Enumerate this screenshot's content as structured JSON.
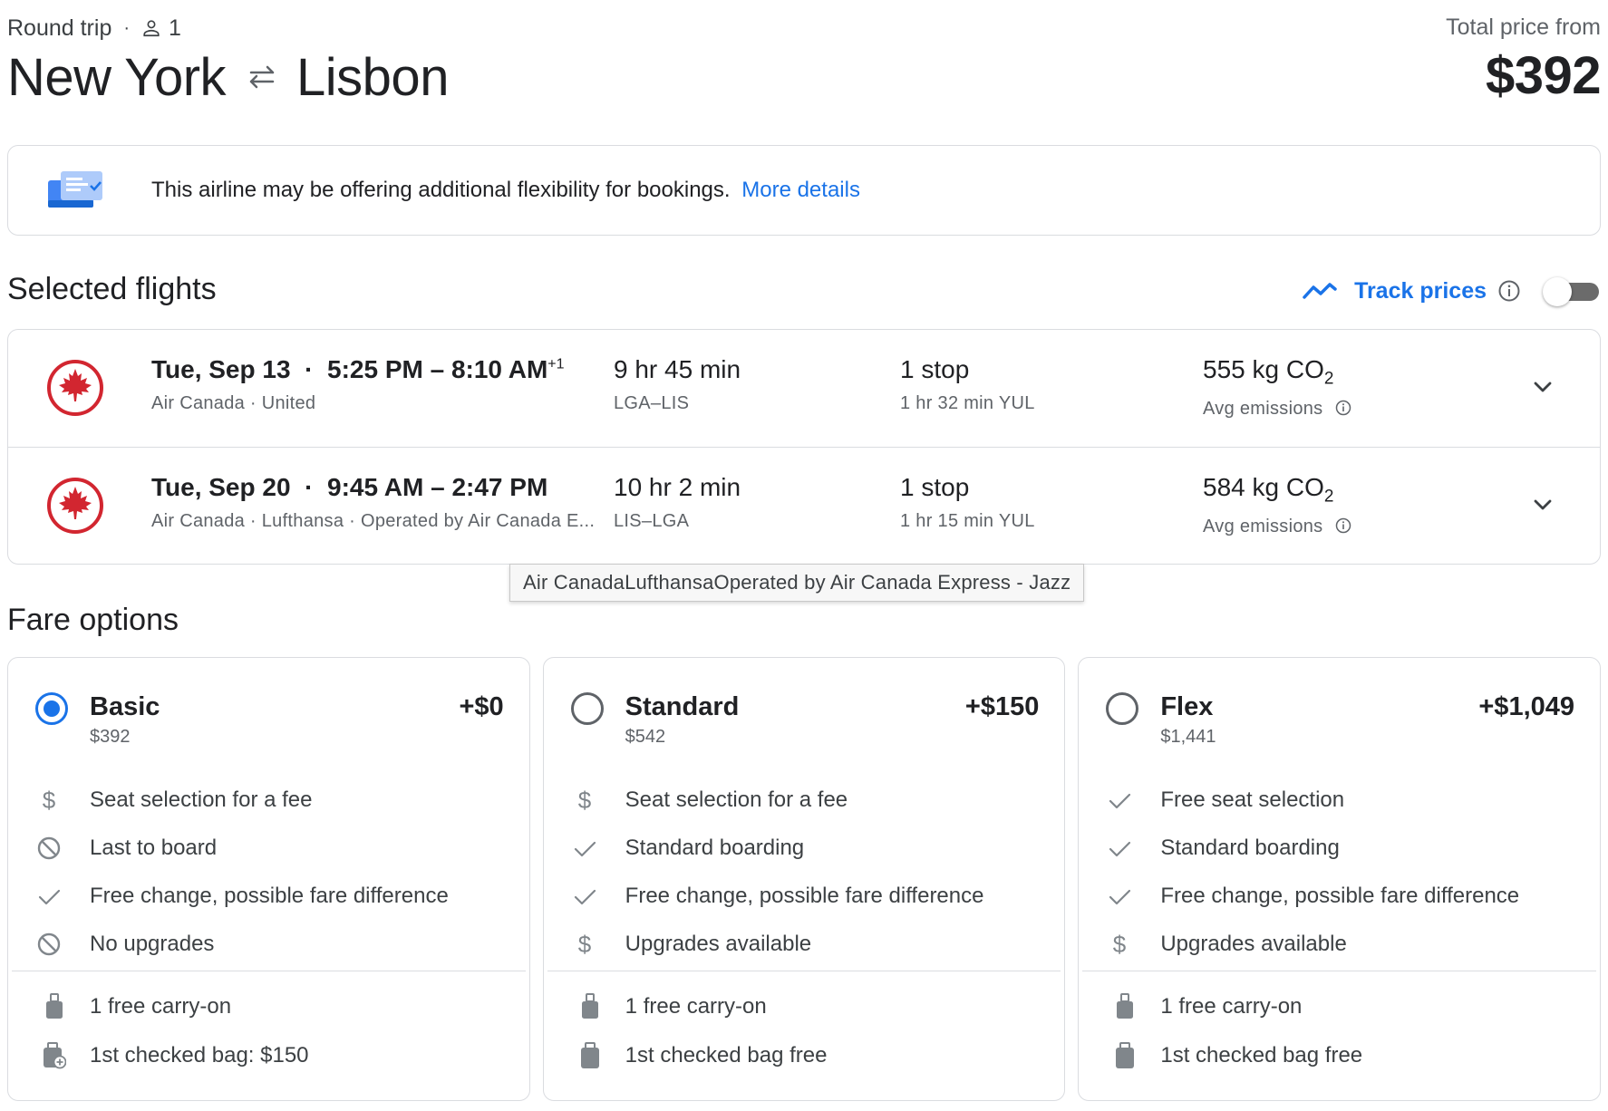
{
  "header": {
    "trip_type": "Round trip",
    "passengers": "1",
    "origin": "New York",
    "destination": "Lisbon",
    "total_label": "Total price from",
    "total_price": "$392"
  },
  "banner": {
    "text": "This airline may be offering additional flexibility for bookings.",
    "link": "More details"
  },
  "selected_flights": {
    "title": "Selected flights",
    "track_prices_label": "Track prices",
    "track_prices_on": false,
    "flights": [
      {
        "date": "Tue, Sep 13",
        "times": "5:25 PM – 8:10 AM",
        "day_offset": "+1",
        "airlines": "Air Canada · United",
        "duration": "9 hr 45 min",
        "airports": "LGA–LIS",
        "stops": "1 stop",
        "layover": "1 hr 32 min YUL",
        "emissions_value": "555 kg CO",
        "emissions_sub": "2",
        "emissions_label": "Avg emissions"
      },
      {
        "date": "Tue, Sep 20",
        "times": "9:45 AM – 2:47 PM",
        "day_offset": "",
        "airlines": "Air Canada · Lufthansa · Operated by Air Canada E...",
        "duration": "10 hr 2 min",
        "airports": "LIS–LGA",
        "stops": "1 stop",
        "layover": "1 hr 15 min YUL",
        "emissions_value": "584 kg CO",
        "emissions_sub": "2",
        "emissions_label": "Avg emissions"
      }
    ],
    "tooltip": "Air CanadaLufthansaOperated by Air Canada Express - Jazz"
  },
  "fare_options": {
    "title": "Fare options",
    "fares": [
      {
        "name": "Basic",
        "price": "$392",
        "delta": "+$0",
        "selected": true,
        "features": [
          {
            "icon": "dollar-icon",
            "text": "Seat selection for a fee"
          },
          {
            "icon": "prohibited-icon",
            "text": "Last to board"
          },
          {
            "icon": "check-icon",
            "text": "Free change, possible fare difference"
          },
          {
            "icon": "prohibited-icon",
            "text": "No upgrades"
          }
        ],
        "bags": [
          {
            "icon": "carry-on-icon",
            "text": "1 free carry-on"
          },
          {
            "icon": "checked-bag-add-icon",
            "text": "1st checked bag: $150"
          }
        ]
      },
      {
        "name": "Standard",
        "price": "$542",
        "delta": "+$150",
        "selected": false,
        "features": [
          {
            "icon": "dollar-icon",
            "text": "Seat selection for a fee"
          },
          {
            "icon": "check-icon",
            "text": "Standard boarding"
          },
          {
            "icon": "check-icon",
            "text": "Free change, possible fare difference"
          },
          {
            "icon": "dollar-icon",
            "text": "Upgrades available"
          }
        ],
        "bags": [
          {
            "icon": "carry-on-icon",
            "text": "1 free carry-on"
          },
          {
            "icon": "checked-bag-icon",
            "text": "1st checked bag free"
          }
        ]
      },
      {
        "name": "Flex",
        "price": "$1,441",
        "delta": "+$1,049",
        "selected": false,
        "features": [
          {
            "icon": "check-icon",
            "text": "Free seat selection"
          },
          {
            "icon": "check-icon",
            "text": "Standard boarding"
          },
          {
            "icon": "check-icon",
            "text": "Free change, possible fare difference"
          },
          {
            "icon": "dollar-icon",
            "text": "Upgrades available"
          }
        ],
        "bags": [
          {
            "icon": "carry-on-icon",
            "text": "1 free carry-on"
          },
          {
            "icon": "checked-bag-icon",
            "text": "1st checked bag free"
          }
        ]
      }
    ]
  },
  "colors": {
    "accent_blue": "#1a73e8",
    "airline_red": "#d22630",
    "text_primary": "#202124",
    "text_secondary": "#5f6368",
    "border": "#dadce0"
  }
}
